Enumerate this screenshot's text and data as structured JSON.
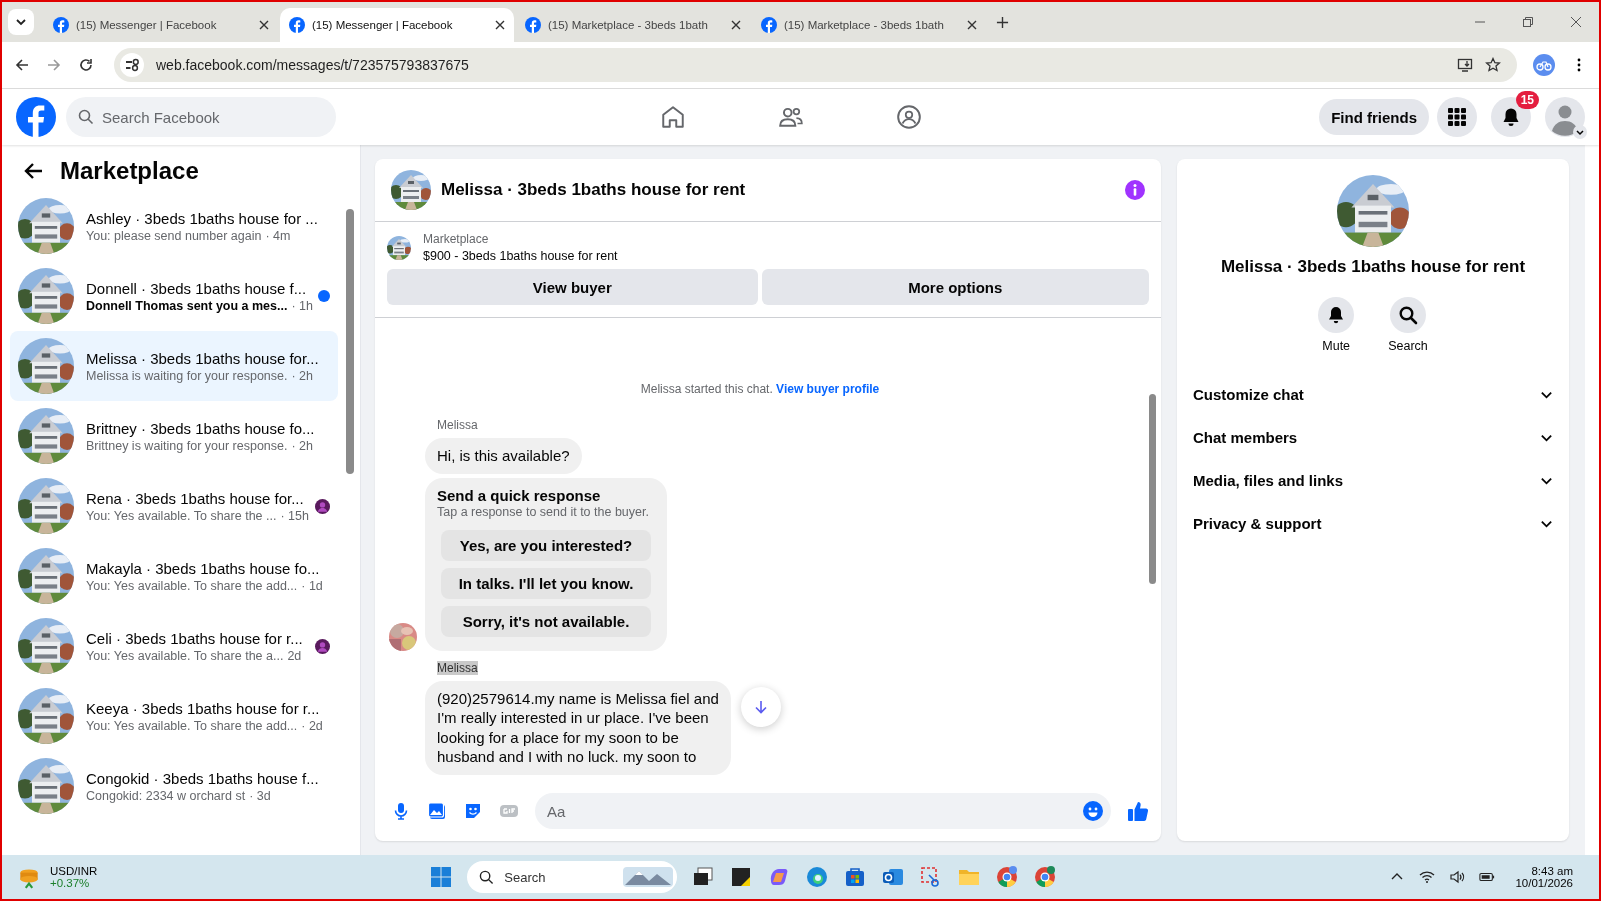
{
  "browser": {
    "tabs": [
      {
        "title": "(15) Messenger | Facebook",
        "selected": false
      },
      {
        "title": "(15) Messenger | Facebook",
        "selected": true
      },
      {
        "title": "(15) Marketplace - 3beds 1bath",
        "selected": false
      },
      {
        "title": "(15) Marketplace - 3beds 1bath",
        "selected": false
      }
    ],
    "url": "web.facebook.com/messages/t/723575793837675"
  },
  "header": {
    "search_placeholder": "Search Facebook",
    "find_friends": "Find friends",
    "notification_count": "15"
  },
  "sidebar": {
    "title": "Marketplace",
    "conversations": [
      {
        "title": "Ashley · 3beds 1baths house for ...",
        "preview": "You: please send number again",
        "time": "· 4m",
        "selected": false,
        "unread": false,
        "seen": false
      },
      {
        "title": "Donnell · 3beds 1baths house f...",
        "preview": "Donnell Thomas sent you a mes...",
        "time": "· 1h",
        "selected": false,
        "unread": true,
        "seen": false
      },
      {
        "title": "Melissa · 3beds 1baths house for...",
        "preview": "Melissa is waiting for your response.",
        "time": "· 2h",
        "selected": true,
        "unread": false,
        "seen": false
      },
      {
        "title": "Brittney · 3beds 1baths house fo...",
        "preview": "Brittney is waiting for your response.",
        "time": "· 2h",
        "selected": false,
        "unread": false,
        "seen": false
      },
      {
        "title": "Rena · 3beds 1baths house for...",
        "preview": "You: Yes available. To share the ...",
        "time": "· 15h",
        "selected": false,
        "unread": false,
        "seen": true
      },
      {
        "title": "Makayla · 3beds 1baths house fo...",
        "preview": "You: Yes available. To share the add...",
        "time": "· 1d",
        "selected": false,
        "unread": false,
        "seen": false
      },
      {
        "title": "Celi · 3beds 1baths house for r...",
        "preview": "You: Yes available. To share the a...",
        "time": "2d",
        "selected": false,
        "unread": false,
        "seen": true
      },
      {
        "title": "Keeya · 3beds 1baths house for r...",
        "preview": "You: Yes available. To share the add...",
        "time": "· 2d",
        "selected": false,
        "unread": false,
        "seen": false
      },
      {
        "title": "Congokid · 3beds 1baths house f...",
        "preview": "Congokid: 2334 w orchard st",
        "time": "· 3d",
        "selected": false,
        "unread": false,
        "seen": false
      }
    ]
  },
  "chat": {
    "title": "Melissa · 3beds 1baths house for rent",
    "listing_label": "Marketplace",
    "listing": "$900 - 3beds 1baths house for rent",
    "buttons": [
      "View buyer",
      "More options"
    ],
    "started_note": "Melissa started this chat.",
    "profile_link": "View buyer profile",
    "groups": [
      {
        "sender": "Melissa",
        "highlighted": false,
        "messages": [
          {
            "kind": "bubble",
            "lines": [
              "Hi, is this available?"
            ]
          },
          {
            "kind": "quick_response",
            "title": "Send a quick response",
            "subtitle": "Tap a response to send it to the buyer.",
            "options": [
              "Yes, are you interested?",
              "In talks. I'll let you know.",
              "Sorry, it's not available."
            ]
          }
        ]
      },
      {
        "sender": "Melissa",
        "highlighted": true,
        "messages": [
          {
            "kind": "bubble",
            "lines": [
              "(920)2579614.my name is Melissa fiel and",
              "I'm really interested in ur place. I've been",
              "looking for a place for my soon to be",
              "husband and I with no luck. my soon to"
            ]
          }
        ]
      }
    ],
    "composer_placeholder": "Aa"
  },
  "details": {
    "title": "Melissa · 3beds 1baths house for rent",
    "actions": [
      {
        "kind": "mute",
        "label": "Mute"
      },
      {
        "kind": "search",
        "label": "Search"
      }
    ],
    "sections": [
      {
        "label": "Customize chat",
        "expanded": false
      },
      {
        "label": "Chat members",
        "expanded": false
      },
      {
        "label": "Media, files and links",
        "expanded": false
      },
      {
        "label": "Privacy & support",
        "expanded": false
      }
    ]
  },
  "taskbar": {
    "widget_title": "USD/INR",
    "widget_change": "+0.37%",
    "search": "Search",
    "time": "8:43 am",
    "date": "10/01/2026"
  }
}
